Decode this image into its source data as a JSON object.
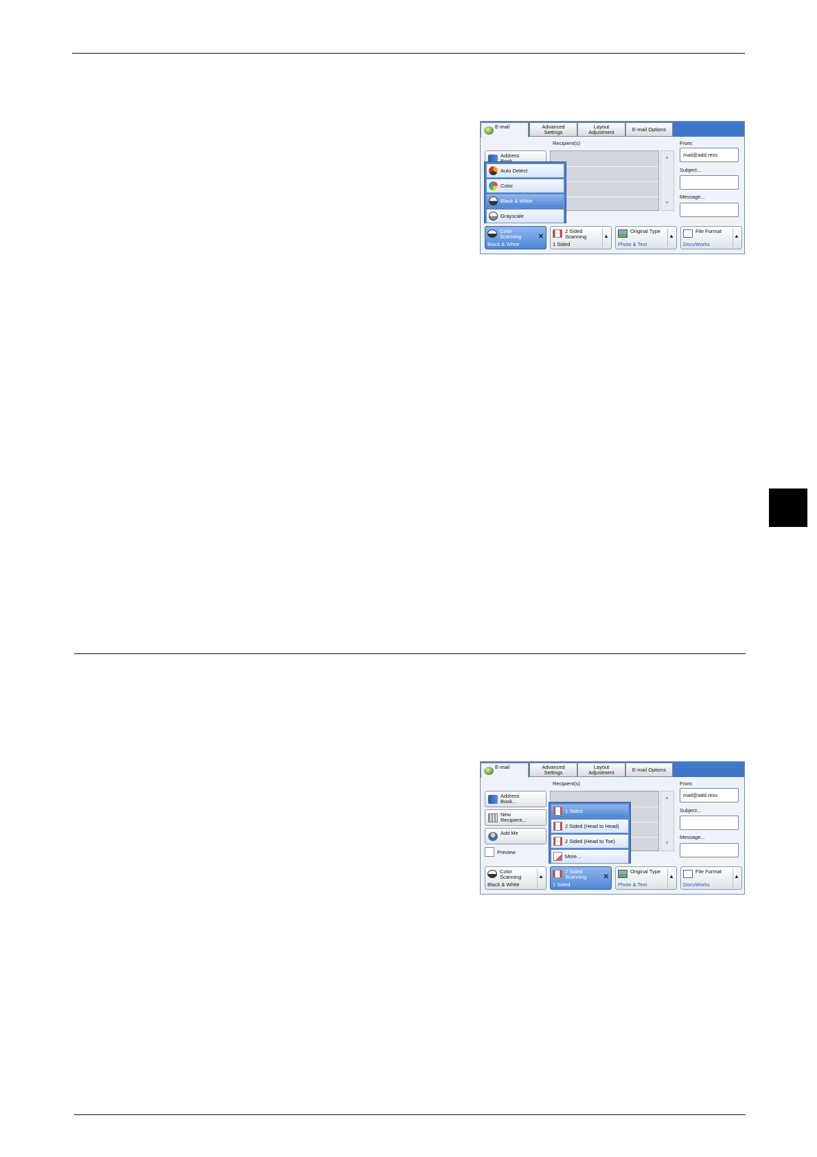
{
  "screenshot_1": {
    "tabs": {
      "email": "E-mail",
      "advanced_line1": "Advanced",
      "advanced_line2": "Settings",
      "layout_line1": "Layout",
      "layout_line2": "Adjustment",
      "email_options": "E-mail Options"
    },
    "recipients_label": "Recipient(s)",
    "from_label": "From:",
    "from_value": "mail@add.ress",
    "subject_label": "Subject...",
    "message_label": "Message...",
    "address_book_line1": "Address",
    "address_book_line2": "Book...",
    "color_menu": [
      {
        "label": "Auto Detect"
      },
      {
        "label": "Color"
      },
      {
        "label": "Black & White"
      },
      {
        "label": "Grayscale"
      }
    ],
    "color_menu_selected": "Black & White",
    "bottom": {
      "color_line1": "Color",
      "color_line2": "Scanning",
      "color_value": "Black & White",
      "sided_line1": "2 Sided",
      "sided_line2": "Scanning",
      "sided_value": "1 Sided",
      "orig_title": "Original Type",
      "orig_value": "Photo & Text",
      "file_title": "File Format",
      "file_value": "DocuWorks"
    }
  },
  "screenshot_2": {
    "tabs": {
      "email": "E-mail",
      "advanced_line1": "Advanced",
      "advanced_line2": "Settings",
      "layout_line1": "Layout",
      "layout_line2": "Adjustment",
      "email_options": "E-mail Options"
    },
    "recipients_label": "Recipient(s)",
    "from_label": "From:",
    "from_value": "mail@add.ress",
    "subject_label": "Subject...",
    "message_label": "Message...",
    "address_book_line1": "Address",
    "address_book_line2": "Book...",
    "new_recipient_line1": "New",
    "new_recipient_line2": "Recipient...",
    "add_me": "Add Me",
    "preview": "Preview",
    "sided_menu": [
      {
        "label": "1 Sided"
      },
      {
        "label": "2 Sided (Head to Head)"
      },
      {
        "label": "2 Sided (Head to Toe)"
      },
      {
        "label": "More..."
      }
    ],
    "sided_menu_selected": "1 Sided",
    "bottom": {
      "color_line1": "Color",
      "color_line2": "Scanning",
      "color_value": "Black & White",
      "sided_line1": "2 Sided",
      "sided_line2": "Scanning",
      "sided_value": "1 Sided",
      "orig_title": "Original Type",
      "orig_value": "Photo & Text",
      "file_title": "File Format",
      "file_value": "DocuWorks"
    }
  },
  "colors": {
    "accent": "#3f78c8",
    "selected": "#4f86d6",
    "value_text": "#1f56b0",
    "chapter_tab": "#000000"
  }
}
